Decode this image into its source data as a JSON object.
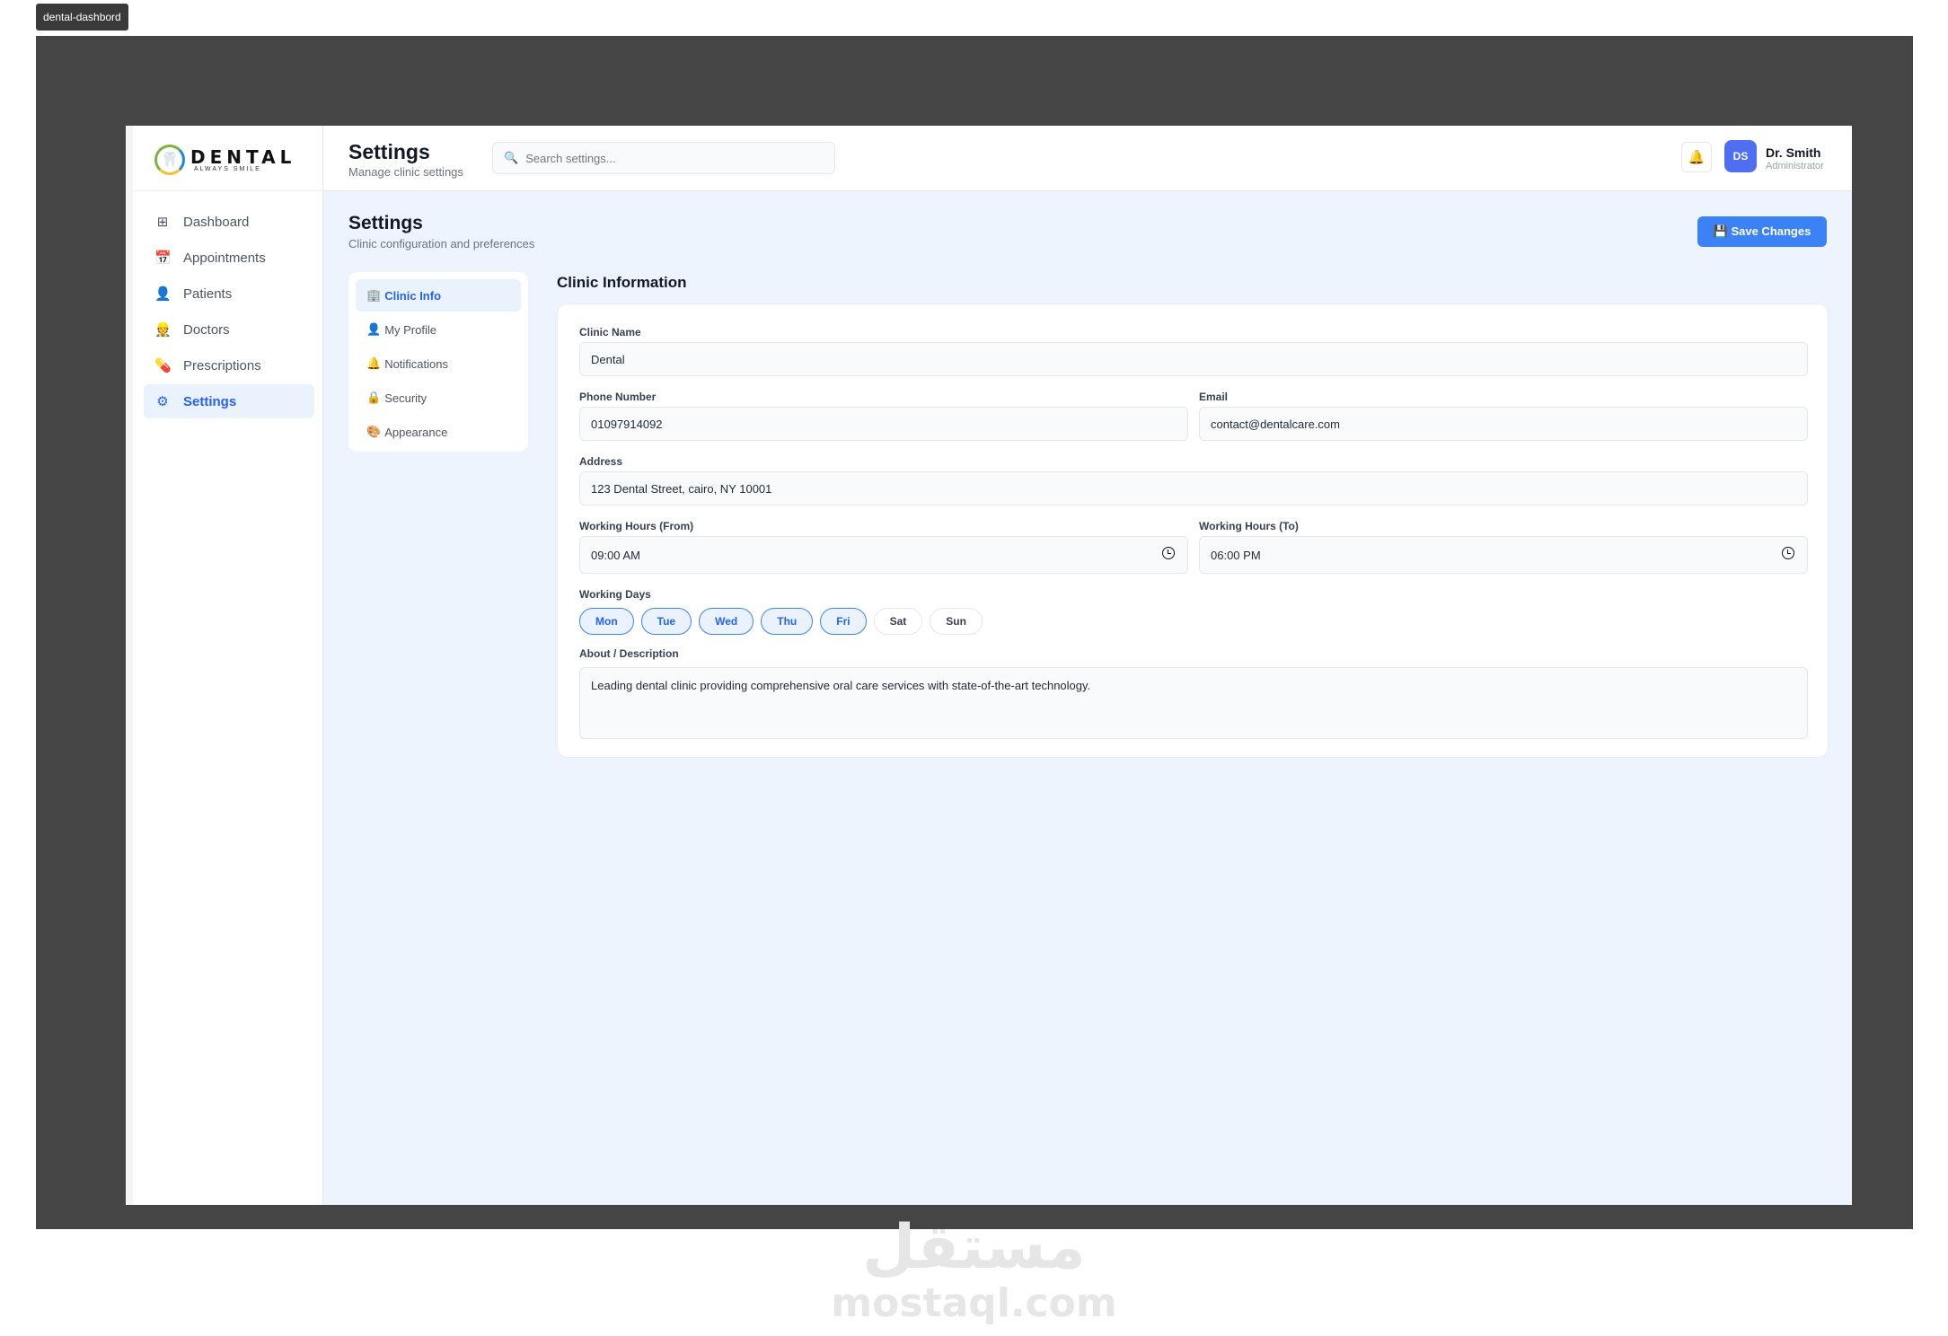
{
  "window": {
    "tab_label": "dental-dashbord"
  },
  "logo": {
    "word": "DENTAL",
    "tagline": "ALWAYS SMILE"
  },
  "sidebar": {
    "items": [
      {
        "icon": "grid-icon",
        "glyph": "⊞",
        "label": "Dashboard",
        "active": false
      },
      {
        "icon": "calendar-icon",
        "glyph": "📅",
        "label": "Appointments",
        "active": false
      },
      {
        "icon": "user-icon",
        "glyph": "👤",
        "label": "Patients",
        "active": false
      },
      {
        "icon": "doctor-icon",
        "glyph": "👷",
        "label": "Doctors",
        "active": false
      },
      {
        "icon": "pill-icon",
        "glyph": "💊",
        "label": "Prescriptions",
        "active": false
      },
      {
        "icon": "gear-icon",
        "glyph": "⚙",
        "label": "Settings",
        "active": true
      }
    ]
  },
  "header": {
    "title": "Settings",
    "subtitle": "Manage clinic settings",
    "search_placeholder": "Search settings...",
    "user": {
      "initials": "DS",
      "name": "Dr. Smith",
      "role": "Administrator"
    }
  },
  "page": {
    "title": "Settings",
    "subtitle": "Clinic configuration and preferences",
    "save_label": "💾 Save Changes"
  },
  "settings_nav": [
    {
      "icon": "building-icon",
      "glyph": "🏢",
      "label": "Clinic Info",
      "active": true
    },
    {
      "icon": "user-icon",
      "glyph": "👤",
      "label": "My Profile",
      "active": false
    },
    {
      "icon": "bell-icon",
      "glyph": "🔔",
      "label": "Notifications",
      "active": false
    },
    {
      "icon": "lock-icon",
      "glyph": "🔒",
      "label": "Security",
      "active": false
    },
    {
      "icon": "paint-icon",
      "glyph": "🎨",
      "label": "Appearance",
      "active": false
    }
  ],
  "clinic_info": {
    "section_title": "Clinic Information",
    "clinic_name_label": "Clinic Name",
    "clinic_name": "Dental",
    "phone_label": "Phone Number",
    "phone": "01097914092",
    "email_label": "Email",
    "email": "contact@dentalcare.com",
    "address_label": "Address",
    "address": "123 Dental Street, cairo, NY 10001",
    "hours_from_label": "Working Hours (From)",
    "hours_from": "09:00 AM",
    "hours_to_label": "Working Hours (To)",
    "hours_to": "06:00 PM",
    "days_label": "Working Days",
    "days": [
      {
        "label": "Mon",
        "selected": true
      },
      {
        "label": "Tue",
        "selected": true
      },
      {
        "label": "Wed",
        "selected": true
      },
      {
        "label": "Thu",
        "selected": true
      },
      {
        "label": "Fri",
        "selected": true
      },
      {
        "label": "Sat",
        "selected": false
      },
      {
        "label": "Sun",
        "selected": false
      }
    ],
    "about_label": "About / Description",
    "about": "Leading dental clinic providing comprehensive oral care services with state-of-the-art technology."
  },
  "watermark": {
    "arabic": "مستقل",
    "latin": "mostaql.com"
  },
  "colors": {
    "accent": "#3b82f6",
    "active_bg": "#eaf2fd",
    "main_bg": "#eef4fd",
    "frame": "#454545"
  }
}
